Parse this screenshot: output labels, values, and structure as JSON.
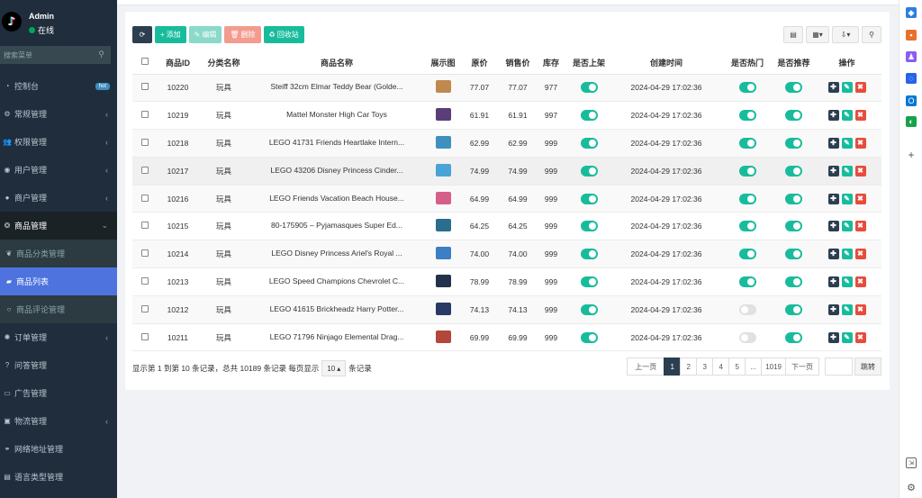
{
  "user": {
    "name": "Admin",
    "status": "在线"
  },
  "search": {
    "placeholder": "搜索菜单"
  },
  "menu": [
    {
      "label": "控制台",
      "icon": "dashboard-icon",
      "badge": "hot"
    },
    {
      "label": "常规管理",
      "icon": "gears-icon"
    },
    {
      "label": "权限管理",
      "icon": "group-icon"
    },
    {
      "label": "用户管理",
      "icon": "user-icon"
    },
    {
      "label": "商户管理",
      "icon": "apple-icon"
    },
    {
      "label": "商品管理",
      "icon": "product-icon"
    }
  ],
  "submenu": [
    {
      "label": "商品分类管理",
      "icon": "leaf-icon"
    },
    {
      "label": "商品列表",
      "icon": "shopping-bag-icon"
    },
    {
      "label": "商品评论管理",
      "icon": "circle-icon"
    }
  ],
  "menu2": [
    {
      "label": "订单管理",
      "icon": "cog-icon"
    },
    {
      "label": "问答管理",
      "icon": "question-icon"
    },
    {
      "label": "广告管理",
      "icon": "ad-icon"
    },
    {
      "label": "物流管理",
      "icon": "truck-icon"
    },
    {
      "label": "网络地址管理",
      "icon": "link-icon"
    },
    {
      "label": "语言类型管理",
      "icon": "language-icon"
    }
  ],
  "toolbar": {
    "add": "添加",
    "edit": "编辑",
    "delete": "删除",
    "recycle": "回收站"
  },
  "table": {
    "headers": [
      "商品ID",
      "分类名称",
      "商品名称",
      "展示图",
      "原价",
      "销售价",
      "库存",
      "是否上架",
      "创建时间",
      "是否热门",
      "是否推荐",
      "操作"
    ],
    "rows": [
      {
        "id": "10220",
        "cat": "玩具",
        "name": "Steiff 32cm Elmar Teddy Bear (Golde...",
        "price": "77.07",
        "sale": "77.07",
        "stock": "977",
        "on": true,
        "time": "2024-04-29 17:02:36",
        "hot": true,
        "rec": true,
        "thumb": "#c0894f"
      },
      {
        "id": "10219",
        "cat": "玩具",
        "name": "Mattel Monster High Car Toys",
        "price": "61.91",
        "sale": "61.91",
        "stock": "997",
        "on": true,
        "time": "2024-04-29 17:02:36",
        "hot": true,
        "rec": true,
        "thumb": "#5a3e78"
      },
      {
        "id": "10218",
        "cat": "玩具",
        "name": "LEGO 41731 Friends Heartlake Intern...",
        "price": "62.99",
        "sale": "62.99",
        "stock": "999",
        "on": true,
        "time": "2024-04-29 17:02:36",
        "hot": true,
        "rec": true,
        "thumb": "#3f8fbf"
      },
      {
        "id": "10217",
        "cat": "玩具",
        "name": "LEGO 43206 Disney Princess Cinder...",
        "price": "74.99",
        "sale": "74.99",
        "stock": "999",
        "on": true,
        "time": "2024-04-29 17:02:36",
        "hot": true,
        "rec": true,
        "thumb": "#4aa3d6"
      },
      {
        "id": "10216",
        "cat": "玩具",
        "name": "LEGO Friends Vacation Beach House...",
        "price": "64.99",
        "sale": "64.99",
        "stock": "999",
        "on": true,
        "time": "2024-04-29 17:02:36",
        "hot": true,
        "rec": true,
        "thumb": "#d65f8a"
      },
      {
        "id": "10215",
        "cat": "玩具",
        "name": "80-175905 – Pyjamasques Super Ed...",
        "price": "64.25",
        "sale": "64.25",
        "stock": "999",
        "on": true,
        "time": "2024-04-29 17:02:36",
        "hot": true,
        "rec": true,
        "thumb": "#2b6d8c"
      },
      {
        "id": "10214",
        "cat": "玩具",
        "name": "LEGO Disney Princess Ariel's Royal ...",
        "price": "74.00",
        "sale": "74.00",
        "stock": "999",
        "on": true,
        "time": "2024-04-29 17:02:36",
        "hot": true,
        "rec": true,
        "thumb": "#3b7fc4"
      },
      {
        "id": "10213",
        "cat": "玩具",
        "name": "LEGO Speed Champions Chevrolet C...",
        "price": "78.99",
        "sale": "78.99",
        "stock": "999",
        "on": true,
        "time": "2024-04-29 17:02:36",
        "hot": true,
        "rec": true,
        "thumb": "#22324a"
      },
      {
        "id": "10212",
        "cat": "玩具",
        "name": "LEGO 41615 Brickheadz Harry Potter...",
        "price": "74.13",
        "sale": "74.13",
        "stock": "999",
        "on": true,
        "time": "2024-04-29 17:02:36",
        "hot": false,
        "rec": true,
        "thumb": "#2a3a66"
      },
      {
        "id": "10211",
        "cat": "玩具",
        "name": "LEGO 71796 Ninjago Elemental Drag...",
        "price": "69.99",
        "sale": "69.99",
        "stock": "999",
        "on": true,
        "time": "2024-04-29 17:02:36",
        "hot": false,
        "rec": true,
        "thumb": "#b3473a"
      }
    ]
  },
  "footer": {
    "info": "显示第 1 到第 10 条记录，总共 10189 条记录 每页显示",
    "per_page": "10",
    "suffix": "条记录"
  },
  "pager": {
    "prev": "上一页",
    "pages": [
      "1",
      "2",
      "3",
      "4",
      "5",
      "...",
      "1019"
    ],
    "next": "下一页",
    "jump": "跳转"
  },
  "colors": {
    "accent": "#18bc9c",
    "sidebar": "#1f2d3d",
    "active": "#4e73df"
  }
}
